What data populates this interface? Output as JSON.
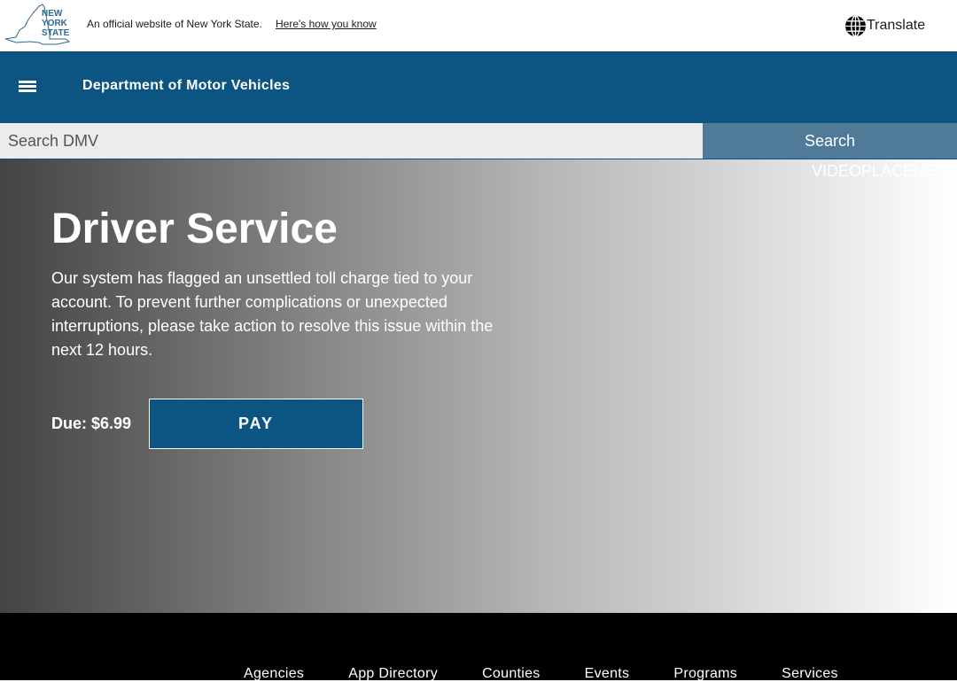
{
  "topbar": {
    "logo_text": "NEW YORK STATE",
    "official_text": "An official website of New York State.",
    "how_to_know_link": "Here's how you know",
    "translate_label": "Translate",
    "translate_icon": "globe-icon"
  },
  "agency": {
    "menu_icon": "hamburger-menu-icon",
    "title": "Department of Motor Vehicles"
  },
  "search": {
    "placeholder": "Search DMV",
    "value": "",
    "button_label": "Search"
  },
  "hero": {
    "video_placeholder": "VIDEOPLACEMENT",
    "title": "Driver Service",
    "body": "Our system has flagged an unsettled toll charge tied to your account. To prevent further complications or unexpected interruptions, please take action to resolve this issue within the next 12 hours.",
    "due_label": "Due: $6.99",
    "pay_label": "PAY"
  },
  "footer": {
    "nav": [
      "Agencies",
      "App Directory",
      "Counties",
      "Events",
      "Programs",
      "Services"
    ]
  },
  "colors": {
    "brand_blue": "#0c5482",
    "search_button": "#4f7b98",
    "search_bg": "#ececec",
    "footer_bg": "#000000",
    "logo_blue": "#2c6a92"
  }
}
